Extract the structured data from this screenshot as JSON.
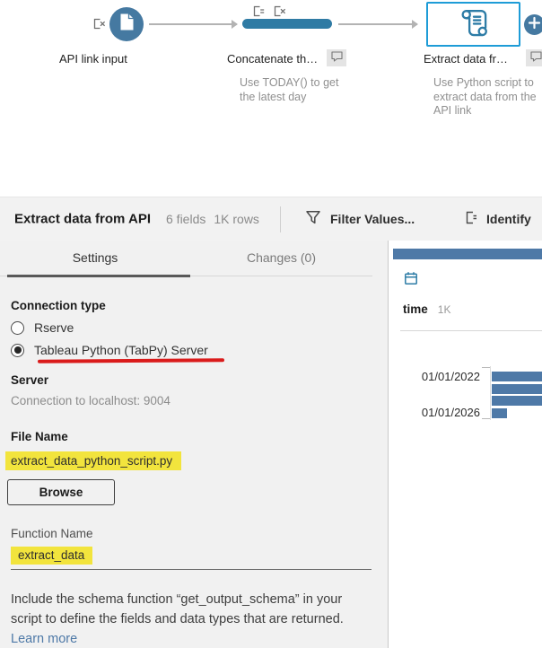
{
  "colors": {
    "node_blue": "#4579a1",
    "pill_blue": "#2f7ba4",
    "selection_blue": "#1e9cd7",
    "bar_blue": "#4e79a7",
    "highlight_yellow": "#f2e43d",
    "annotation_red": "#da1b1b",
    "link_blue": "#4e79a7"
  },
  "flow": {
    "nodes": {
      "input": {
        "label": "API link input"
      },
      "concatenate": {
        "label": "Concatenate th…",
        "caption": "Use TODAY() to get the latest day"
      },
      "script": {
        "label": "Extract data fr…",
        "caption": "Use Python script to extract data from the API link",
        "selected": true
      }
    }
  },
  "toolbar": {
    "title": "Extract data from API",
    "fields_meta": "6 fields",
    "rows_meta": "1K rows",
    "filter_action": "Filter Values...",
    "identify_action": "Identify"
  },
  "tabs": {
    "settings": "Settings",
    "changes": "Changes (0)"
  },
  "settings": {
    "connection_type_label": "Connection type",
    "radio_rserve": "Rserve",
    "radio_tabpy": "Tableau Python (TabPy) Server",
    "selected_connection": "Tableau Python (TabPy) Server",
    "server_label": "Server",
    "server_value": "Connection to localhost: 9004",
    "file_name_label": "File Name",
    "file_name_value": "extract_data_python_script.py",
    "browse_button": "Browse",
    "function_name_label": "Function Name",
    "function_name_value": "extract_data",
    "schema_note_prefix": "Include the schema function “get_output_schema” in your script to define the fields and data types that are returned. ",
    "learn_more_link": "Learn more"
  },
  "profile": {
    "field_name": "time",
    "field_count": "1K",
    "histogram": {
      "type": "bar",
      "orientation": "horizontal",
      "bars": [
        {
          "label": "01/01/2022",
          "width": 57,
          "clipped": true
        },
        {
          "label": "",
          "width": 57,
          "clipped": true
        },
        {
          "label": "",
          "width": 57,
          "clipped": true
        },
        {
          "label": "01/01/2026",
          "width": 17,
          "clipped": false
        }
      ]
    }
  }
}
